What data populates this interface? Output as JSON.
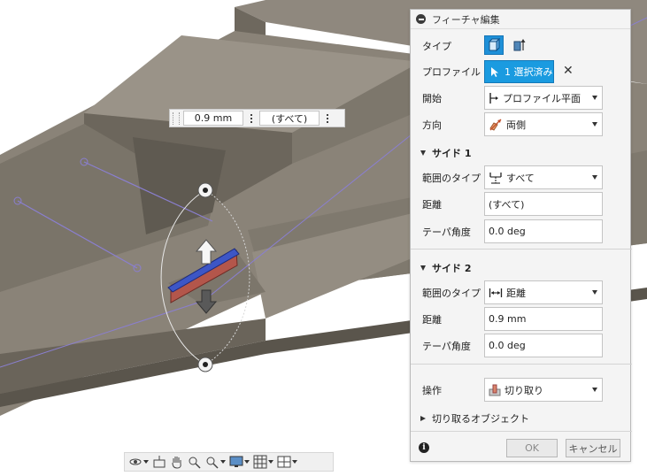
{
  "viewport": {
    "distance_field_value": "0.9 mm",
    "distance_field_all": "(すべて)"
  },
  "dialog": {
    "title": "フィーチャ編集",
    "type_label": "タイプ",
    "profile_label": "プロファイル",
    "profile_button": "1 選択済み",
    "start_label": "開始",
    "start_value": "プロファイル平面",
    "direction_label": "方向",
    "direction_value": "両側",
    "side1": {
      "title": "サイド 1",
      "extent_label": "範囲のタイプ",
      "extent_value": "すべて",
      "distance_label": "距離",
      "distance_value": "(すべて)",
      "taper_label": "テーパ角度",
      "taper_value": "0.0 deg"
    },
    "side2": {
      "title": "サイド 2",
      "extent_label": "範囲のタイプ",
      "extent_value": "距離",
      "distance_label": "距離",
      "distance_value": "0.9 mm",
      "taper_label": "テーパ角度",
      "taper_value": "0.0 deg"
    },
    "operation_label": "操作",
    "operation_value": "切り取り",
    "objects_to_cut": "切り取るオブジェクト",
    "ok": "OK",
    "cancel": "キャンセル"
  },
  "colors": {
    "accent": "#1a9be0",
    "body_face_top": "#8c857b",
    "body_face_side": "#6f695f",
    "sketch_line": "#8a7fd0"
  },
  "toolbar_icons": [
    "orbit-icon",
    "look-at-icon",
    "pan-icon",
    "zoom-icon",
    "fit-icon",
    "display-settings-icon",
    "grid-icon",
    "viewports-icon"
  ]
}
